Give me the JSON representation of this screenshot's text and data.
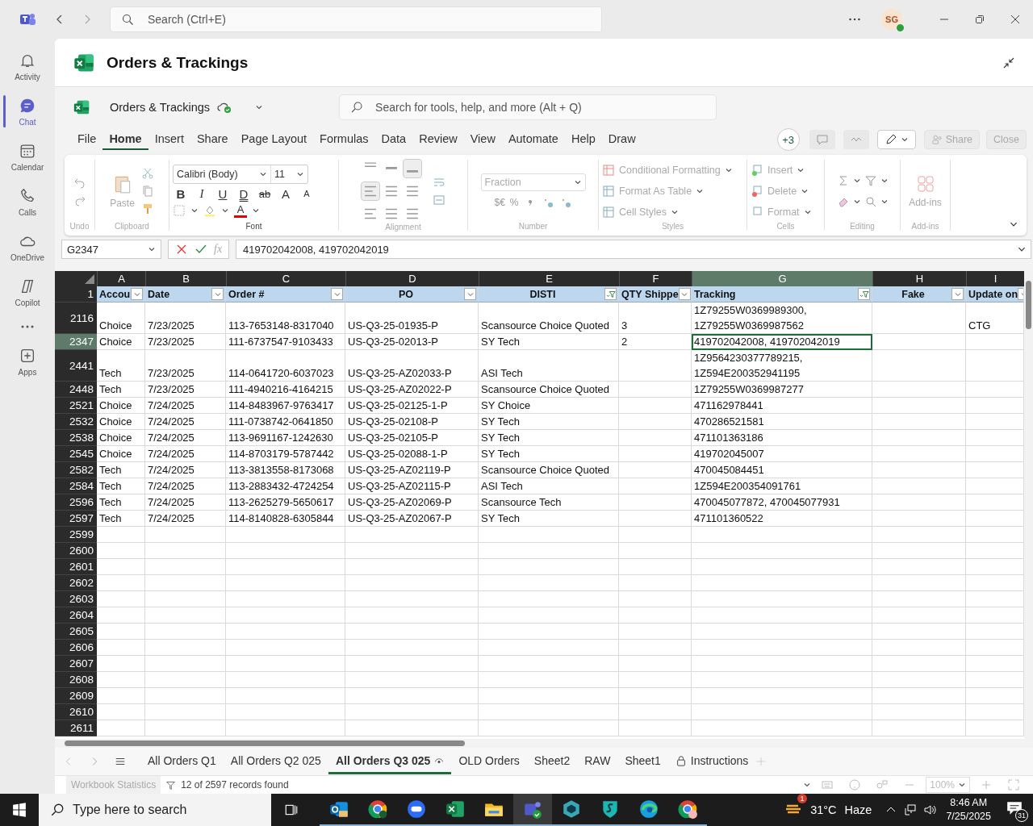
{
  "titlebar": {
    "search_placeholder": "Search (Ctrl+E)",
    "avatar": "SG"
  },
  "rail": [
    {
      "label": "Activity",
      "selected": false
    },
    {
      "label": "Chat",
      "selected": true
    },
    {
      "label": "Calendar",
      "selected": false
    },
    {
      "label": "Calls",
      "selected": false
    },
    {
      "label": "OneDrive",
      "selected": false
    },
    {
      "label": "Copilot",
      "selected": false
    },
    {
      "label": "Apps",
      "selected": false
    }
  ],
  "app_title": "Orders & Trackings",
  "workbook": {
    "name": "Orders & Trackings",
    "search_placeholder": "Search for tools, help, and more (Alt + Q)"
  },
  "menu": [
    {
      "label": "File",
      "selected": false
    },
    {
      "label": "Home",
      "selected": true
    },
    {
      "label": "Insert",
      "selected": false
    },
    {
      "label": "Share",
      "selected": false
    },
    {
      "label": "Page Layout",
      "selected": false
    },
    {
      "label": "Formulas",
      "selected": false
    },
    {
      "label": "Data",
      "selected": false
    },
    {
      "label": "Review",
      "selected": false
    },
    {
      "label": "View",
      "selected": false
    },
    {
      "label": "Automate",
      "selected": false
    },
    {
      "label": "Help",
      "selected": false
    },
    {
      "label": "Draw",
      "selected": false
    }
  ],
  "collaborators": "+3",
  "share_button": {
    "label": "Share",
    "disabled": true
  },
  "close_button": {
    "label": "Close",
    "disabled": true
  },
  "ribbon": {
    "groups": [
      "Undo",
      "Clipboard",
      "Font",
      "Alignment",
      "Number",
      "Styles",
      "Cells",
      "Editing",
      "Add-ins"
    ],
    "paste": "Paste",
    "font": "Calibri (Body)",
    "font_size": "11",
    "format_buttons": [
      "B",
      "I",
      "U",
      "D",
      "ab",
      "A",
      "A"
    ],
    "font_color": "A",
    "number_format": "Fraction",
    "currency": "$€",
    "percent": "%",
    "styles": [
      "Conditional Formatting",
      "Format As Table",
      "Cell Styles"
    ],
    "cells": [
      "Insert",
      "Delete",
      "Format"
    ],
    "addins": "Add-ins",
    "disabled": true
  },
  "formula_bar": {
    "name_box": "G2347",
    "fx": "fx",
    "value": "419702042008, 419702042019"
  },
  "grid": {
    "header_row_number": "1",
    "columns": [
      {
        "letter": "A",
        "selected": false,
        "header": "Accou",
        "filtered": false,
        "centered": false
      },
      {
        "letter": "B",
        "selected": false,
        "header": "Date",
        "filtered": false,
        "centered": false
      },
      {
        "letter": "C",
        "selected": false,
        "header": "Order #",
        "filtered": false,
        "centered": false
      },
      {
        "letter": "D",
        "selected": false,
        "header": "PO",
        "filtered": false,
        "centered": true
      },
      {
        "letter": "E",
        "selected": false,
        "header": "DISTI",
        "filtered": true,
        "centered": true
      },
      {
        "letter": "F",
        "selected": false,
        "header": "QTY Shippe",
        "filtered": false
      },
      {
        "letter": "G",
        "selected": true,
        "header": "Tracking",
        "filtered": true,
        "centered": false
      },
      {
        "letter": "H",
        "selected": false,
        "header": "Fake",
        "filtered": false,
        "centered": true
      },
      {
        "letter": "I",
        "selected": false,
        "header": "Update on",
        "filtered": false
      }
    ],
    "rows": [
      {
        "number": "2116",
        "selected": false,
        "cells": {
          "A": "Choice",
          "B": "7/23/2025",
          "C": "113-7653148-8317040",
          "D": "US-Q3-25-01935-P",
          "E": "Scansource Choice Quoted",
          "F": "3",
          "G": "1Z79255W0369989300, 1Z79255W0369987562",
          "I": "CTG"
        }
      },
      {
        "number": "2347",
        "selected": true,
        "cells": {
          "A": "Choice",
          "B": "7/23/2025",
          "C": "111-6737547-9103433",
          "D": "US-Q3-25-02013-P",
          "E": "SY Tech",
          "F": "2",
          "G": "419702042008, 419702042019"
        }
      },
      {
        "number": "2441",
        "selected": false,
        "cells": {
          "A": "Tech",
          "B": "7/23/2025",
          "C": "114-0641720-6037023",
          "D": "US-Q3-25-AZ02033-P",
          "E": "ASI Tech",
          "G": "1Z9564230377789215, 1Z594E200352941195"
        }
      },
      {
        "number": "2448",
        "selected": false,
        "cells": {
          "A": "Tech",
          "B": "7/23/2025",
          "C": "111-4940216-4164215",
          "D": "US-Q3-25-AZ02022-P",
          "E": "Scansource Choice Quoted",
          "G": "1Z79255W0369987277"
        }
      },
      {
        "number": "2521",
        "selected": false,
        "cells": {
          "A": "Choice",
          "B": "7/24/2025",
          "C": "114-8483967-9763417",
          "D": "US-Q3-25-02125-1-P",
          "E": "SY Choice",
          "G": "471162978441"
        }
      },
      {
        "number": "2532",
        "selected": false,
        "cells": {
          "A": "Choice",
          "B": "7/24/2025",
          "C": "111-0738742-0641850",
          "D": "US-Q3-25-02108-P",
          "E": "SY Tech",
          "G": "470286521581"
        }
      },
      {
        "number": "2538",
        "selected": false,
        "cells": {
          "A": "Choice",
          "B": "7/24/2025",
          "C": "113-9691167-1242630",
          "D": "US-Q3-25-02105-P",
          "E": "SY Tech",
          "G": "471101363186"
        }
      },
      {
        "number": "2545",
        "selected": false,
        "cells": {
          "A": "Choice",
          "B": "7/24/2025",
          "C": "114-8703179-5787442",
          "D": "US-Q3-25-02088-1-P",
          "E": "SY Tech",
          "G": "419702045007"
        }
      },
      {
        "number": "2582",
        "selected": false,
        "cells": {
          "A": "Tech",
          "B": "7/24/2025",
          "C": "113-3813558-8173068",
          "D": "US-Q3-25-AZ02119-P",
          "E": "Scansource Choice Quoted",
          "G": "470045084451"
        }
      },
      {
        "number": "2584",
        "selected": false,
        "cells": {
          "A": "Tech",
          "B": "7/24/2025",
          "C": "113-2883432-4724254",
          "D": "US-Q3-25-AZ02115-P",
          "E": "ASI Tech",
          "G": "1Z594E200354091761"
        }
      },
      {
        "number": "2596",
        "selected": false,
        "cells": {
          "A": "Tech",
          "B": "7/24/2025",
          "C": "113-2625279-5650617",
          "D": "US-Q3-25-AZ02069-P",
          "E": "Scansource Tech",
          "G": "470045077872, 470045077931"
        }
      },
      {
        "number": "2597",
        "selected": false,
        "cells": {
          "A": "Tech",
          "B": "7/24/2025",
          "C": "114-8140828-6305844",
          "D": "US-Q3-25-AZ02067-P",
          "E": "SY Tech",
          "G": "471101360522"
        }
      }
    ],
    "empty_rows": [
      "2599",
      "2600",
      "2601",
      "2602",
      "2603",
      "2604",
      "2605",
      "2606",
      "2607",
      "2608",
      "2609",
      "2610",
      "2611"
    ]
  },
  "sheets": [
    {
      "label": "All Orders Q1",
      "selected": false,
      "locked": false
    },
    {
      "label": "All Orders Q2 025",
      "selected": false,
      "locked": false
    },
    {
      "label": "All Orders Q3 025",
      "selected": true,
      "locked": false
    },
    {
      "label": "OLD Orders",
      "selected": false,
      "locked": false
    },
    {
      "label": "Sheet2",
      "selected": false,
      "locked": false
    },
    {
      "label": "RAW",
      "selected": false,
      "locked": false
    },
    {
      "label": "Sheet1",
      "selected": false,
      "locked": false
    },
    {
      "label": "Instructions",
      "selected": false,
      "locked": true
    }
  ],
  "status": {
    "workbook_statistics": "Workbook Statistics",
    "records": "12 of 2597 records found",
    "zoom": "100%"
  },
  "taskbar": {
    "search_placeholder": "Type here to search",
    "apps": [
      {
        "selected": false
      },
      {
        "selected": false
      },
      {
        "selected": false
      },
      {
        "selected": false
      },
      {
        "selected": false
      },
      {
        "selected": true
      },
      {
        "selected": false
      },
      {
        "selected": false
      },
      {
        "selected": false
      },
      {
        "selected": false
      }
    ],
    "weather_badge": "1",
    "temperature": "31°C",
    "condition": "Haze",
    "time": "8:46 AM",
    "date": "7/25/2025",
    "notifications": "31"
  }
}
